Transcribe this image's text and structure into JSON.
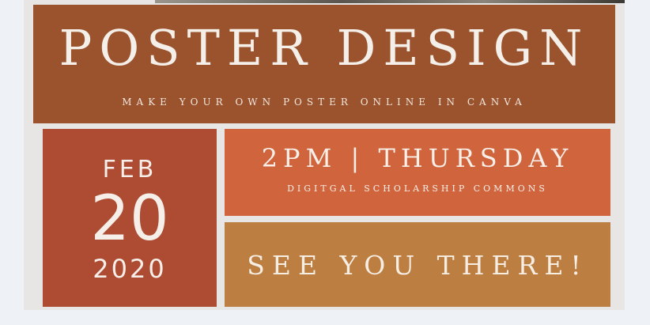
{
  "poster": {
    "title": "POSTER DESIGN",
    "subtitle": "MAKE YOUR OWN POSTER ONLINE IN CANVA",
    "date": {
      "month": "FEB",
      "day": "20",
      "year": "2020"
    },
    "time": "2PM | THURSDAY",
    "location": "DIGITGAL SCHOLARSHIP COMMONS",
    "cta": "SEE YOU THERE!"
  },
  "colors": {
    "background": "#eef1f5",
    "frame": "#e7e6e4",
    "header_band": "#9b532e",
    "date_box": "#ad4b33",
    "time_box": "#d0643d",
    "cta_box": "#bd7e42",
    "text": "#f4efe9"
  }
}
